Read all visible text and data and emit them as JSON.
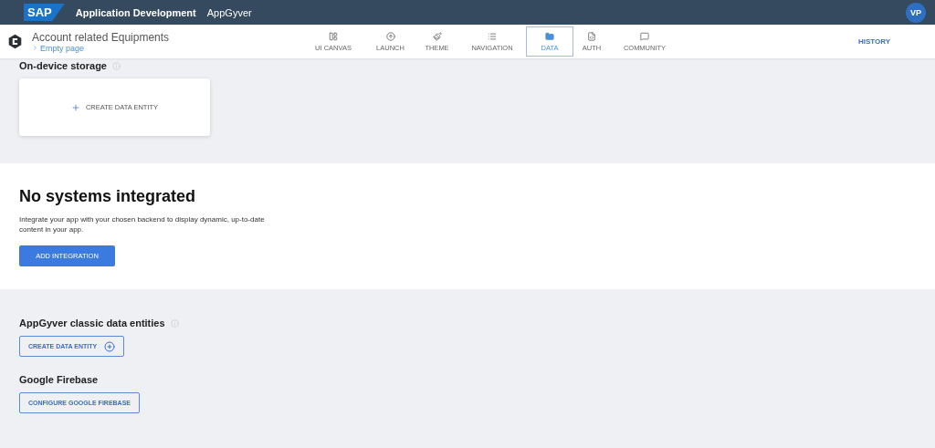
{
  "topbar": {
    "logo": "SAP",
    "title": "Application Development",
    "subtitle": "AppGyver",
    "avatar": "VP"
  },
  "app": {
    "name": "Account related Equipments",
    "page": "Empty page"
  },
  "tabs": [
    {
      "label": "UI CANVAS",
      "kind": "canvas",
      "selected": false
    },
    {
      "label": "LAUNCH",
      "kind": "launch",
      "selected": false
    },
    {
      "label": "THEME",
      "kind": "theme",
      "selected": false
    },
    {
      "label": "NAVIGATION",
      "kind": "navigation",
      "selected": false
    },
    {
      "label": "DATA",
      "kind": "data",
      "selected": true
    },
    {
      "label": "AUTH",
      "kind": "auth",
      "selected": false
    },
    {
      "label": "COMMUNITY",
      "kind": "community",
      "selected": false
    }
  ],
  "history": "HISTORY",
  "storage": {
    "title": "On-device storage",
    "button": "CREATE DATA ENTITY"
  },
  "integration": {
    "title": "No systems integrated",
    "text": "Integrate your app with your chosen backend to display dynamic, up-to-date content in your app.",
    "button": "ADD INTEGRATION"
  },
  "classic": {
    "title": "AppGyver classic data entities",
    "button": "CREATE DATA ENTITY"
  },
  "firebase": {
    "title": "Google Firebase",
    "button": "CONFIGURE GOOGLE FIREBASE"
  }
}
